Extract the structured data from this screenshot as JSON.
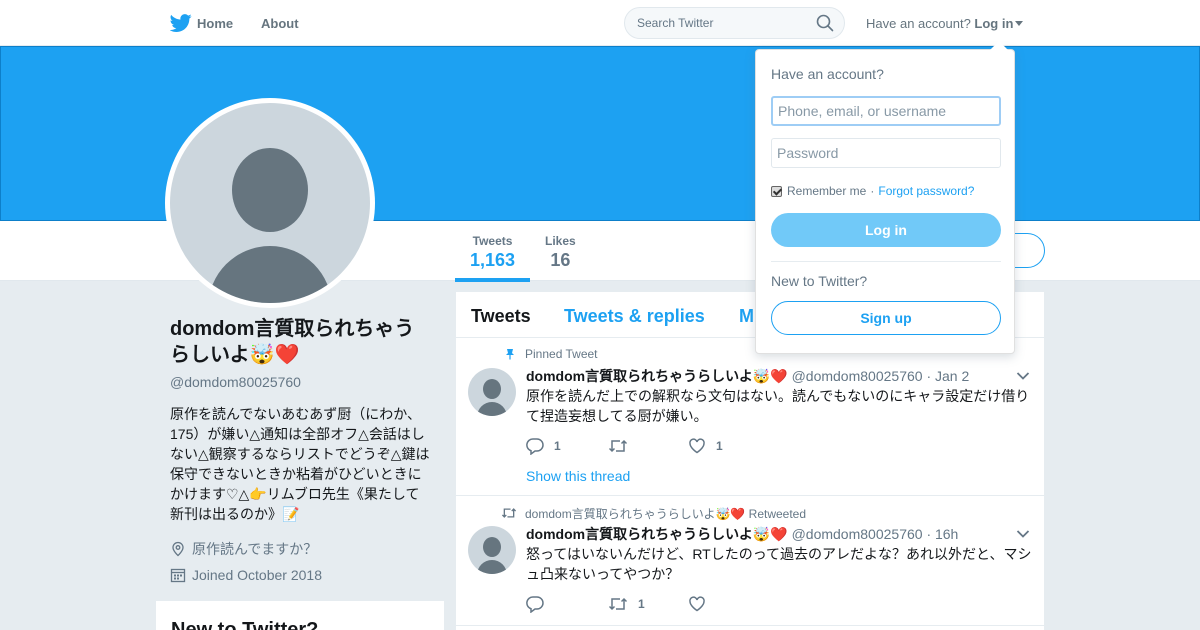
{
  "nav": {
    "home_label": "Home",
    "about_label": "About",
    "search_placeholder": "Search Twitter",
    "have_account": "Have an account?",
    "login_label": "Log in"
  },
  "profile": {
    "name": "domdom言質取られちゃうらしいよ🤯❤️",
    "handle": "@domdom80025760",
    "bio": "原作を読んでないあむあず厨（にわか、175）が嫌い△通知は全部オフ△会話はしない△観察するならリストでどうぞ△鍵は保守できないときか粘着がひどいときにかけます♡△👉リムブロ先生《果たして新刊は出るのか》📝",
    "location": "原作読んでますか？",
    "joined": "Joined October 2018"
  },
  "stats": [
    {
      "label": "Tweets",
      "value": "1,163"
    },
    {
      "label": "Likes",
      "value": "16"
    }
  ],
  "sidebar_card": {
    "title": "New to Twitter?"
  },
  "timeline": {
    "tabs": [
      "Tweets",
      "Tweets & replies",
      "M"
    ],
    "tweets": [
      {
        "context": "Pinned Tweet",
        "author": "domdom言質取られちゃうらしいよ🤯❤️",
        "meta": "@domdom80025760 · Jan 2",
        "text": "原作を読んだ上での解釈なら文句はない。読んでもないのにキャラ設定だけ借りて捏造妄想してる厨が嫌い。",
        "replies": "1",
        "retweets": "",
        "likes": "1",
        "thread_label": "Show this thread"
      },
      {
        "context": "domdom言質取られちゃうらしいよ🤯❤️ Retweeted",
        "author": "domdom言質取られちゃうらしいよ🤯❤️",
        "meta": "@domdom80025760 · 16h",
        "text": "怒ってはいないんだけど、RTしたのって過去のアレだよな？あれ以外だと、マシュ凸来ないってやつか？",
        "replies": "",
        "retweets": "1",
        "likes": ""
      }
    ]
  },
  "login_dropdown": {
    "title": "Have an account?",
    "username_placeholder": "Phone, email, or username",
    "password_placeholder": "Password",
    "remember_label": "Remember me",
    "separator": "·",
    "forgot_label": "Forgot password?",
    "login_button": "Log in",
    "new_label": "New to Twitter?",
    "signup_button": "Sign up"
  },
  "colors": {
    "brand_blue": "#1da1f2",
    "banner": "#1da1f2",
    "background": "#e6ecf0"
  }
}
